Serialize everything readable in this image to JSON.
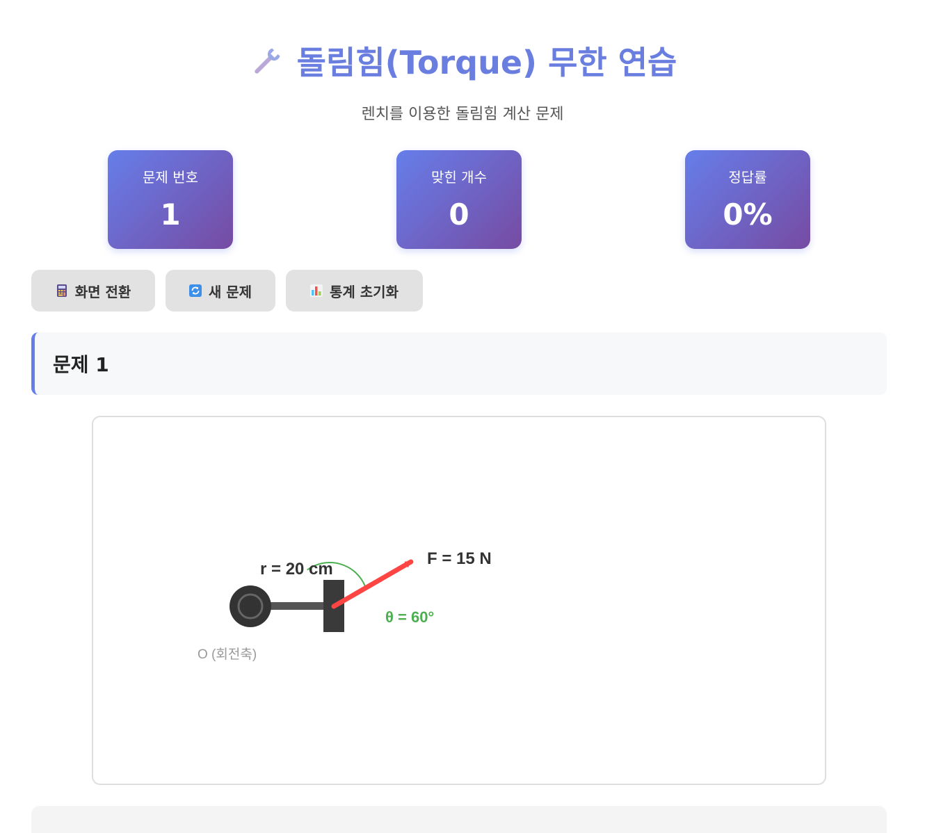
{
  "header": {
    "title": "돌림힘(Torque) 무한 연습",
    "subtitle": "렌치를 이용한 돌림힘 계산 문제",
    "icon": "wrench-icon"
  },
  "stats": [
    {
      "label": "문제 번호",
      "value": "1"
    },
    {
      "label": "맞힌 개수",
      "value": "0"
    },
    {
      "label": "정답률",
      "value": "0%"
    }
  ],
  "toolbar": {
    "switch_view": {
      "label": "화면 전환",
      "icon": "calculator-icon"
    },
    "new_problem": {
      "label": "새 문제",
      "icon": "refresh-icon"
    },
    "reset_stats": {
      "label": "통계 초기화",
      "icon": "bar-chart-icon"
    }
  },
  "problem": {
    "title": "문제 1"
  },
  "diagram": {
    "r_label": "r = 20 cm",
    "f_label": "F = 15 N",
    "angle_label": "θ = 60°",
    "angle_deg": 60,
    "pivot_label": "O (회전축)",
    "colors": {
      "force": "#ff4444",
      "angle": "#4caf50",
      "wrench": "#3a3a3a",
      "handle": "#555555"
    }
  },
  "colors": {
    "accent": "#667eea",
    "accent_end": "#764ba2",
    "title": "#6a7ee0"
  }
}
